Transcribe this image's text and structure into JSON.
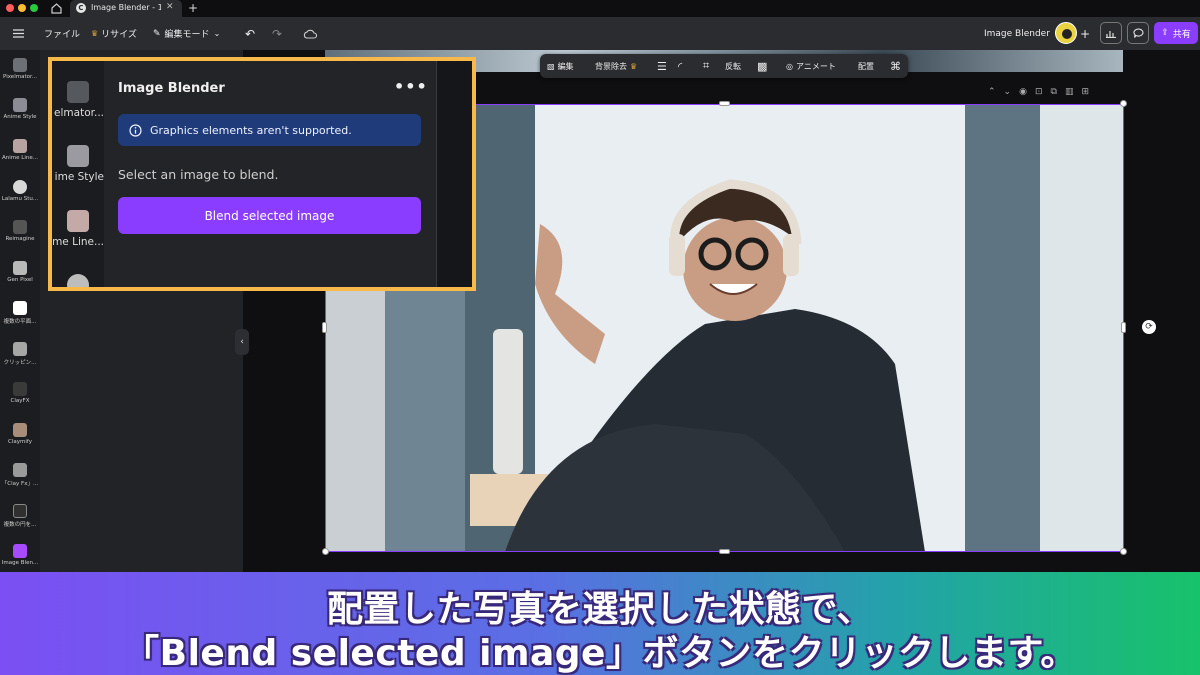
{
  "browser": {
    "tab_title": "Image Blender - 19...",
    "tab_favicon": "C"
  },
  "toolbar": {
    "menu_icon": "hamburger-icon",
    "file": "ファイル",
    "resize": "リサイズ",
    "edit_mode": "編集モード",
    "doc_title": "Image Blender",
    "share": "共有"
  },
  "sidebar": {
    "apps": [
      {
        "label": "Pixelmator...",
        "color": "#6d7075"
      },
      {
        "label": "Anime Style",
        "color": "#8c8c94"
      },
      {
        "label": "Anime Line...",
        "color": "#b7a3a1"
      },
      {
        "label": "Lalamu Stu...",
        "color": "#d8d8d8"
      },
      {
        "label": "Reimagine",
        "color": "#555555"
      },
      {
        "label": "Gen Pixel",
        "color": "#b9b9b9"
      },
      {
        "label": "複数の平面...",
        "color": "#ffffff"
      },
      {
        "label": "クリッピン...",
        "color": "#a6a6a6"
      },
      {
        "label": "ClayFX",
        "color": "#3a3a3a"
      },
      {
        "label": "Claymify",
        "color": "#a88d7a"
      },
      {
        "label": "「Clay Fx」...",
        "color": "#9a9a9a"
      },
      {
        "label": "複数の円を...",
        "color": "#303030"
      },
      {
        "label": "Image Blen...",
        "color": "#a64bff"
      }
    ]
  },
  "callout": {
    "apps": [
      {
        "label": "elmator...",
        "color": "#55585c"
      },
      {
        "label": "ime Style",
        "color": "#9a9aa0"
      },
      {
        "label": "me Line...",
        "color": "#c4aaa6"
      },
      {
        "label": "",
        "color": "#bdbdbd"
      }
    ]
  },
  "panel": {
    "title": "Image Blender",
    "notice": "Graphics elements aren't supported.",
    "hint": "Select an image to blend.",
    "button": "Blend selected image"
  },
  "float_toolbar": {
    "edit": "編集",
    "bg_remove": "背景除去",
    "flip": "反転",
    "animate": "アニメート",
    "arrange": "配置"
  },
  "banner": {
    "line1": "配置した写真を選択した状態で、",
    "line2": "「Blend selected image」ボタンをクリックします。"
  },
  "colors": {
    "accent": "#8b3dff",
    "callout_border": "#f6b94a",
    "notice_bg": "#1f3b7a"
  }
}
